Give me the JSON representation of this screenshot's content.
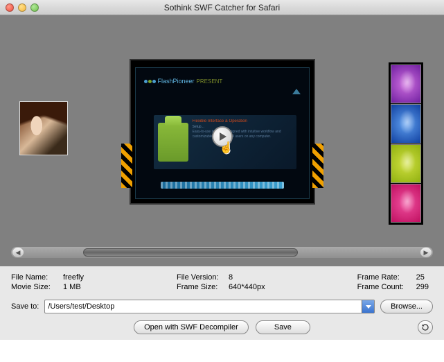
{
  "window": {
    "title": "Sothink SWF Catcher for Safari"
  },
  "preview": {
    "brand": "FlashPioneer",
    "brand_suffix": "PRESENT",
    "content_header": "Flexible Interface & Operation",
    "content_sub": "Setup..."
  },
  "right_thumbs": [
    "purple-swatch",
    "blue-swatch",
    "green-swatch",
    "pink-swatch"
  ],
  "info": {
    "file_name_label": "File Name:",
    "file_name": "freefly",
    "movie_size_label": "Movie Size:",
    "movie_size": "1 MB",
    "file_version_label": "File Version:",
    "file_version": "8",
    "frame_size_label": "Frame Size:",
    "frame_size": "640*440px",
    "frame_rate_label": "Frame Rate:",
    "frame_rate": "25",
    "frame_count_label": "Frame Count:",
    "frame_count": "299"
  },
  "save": {
    "label": "Save to:",
    "path": "/Users/test/Desktop",
    "browse": "Browse..."
  },
  "buttons": {
    "decompile": "Open with SWF Decompiler",
    "save": "Save"
  }
}
